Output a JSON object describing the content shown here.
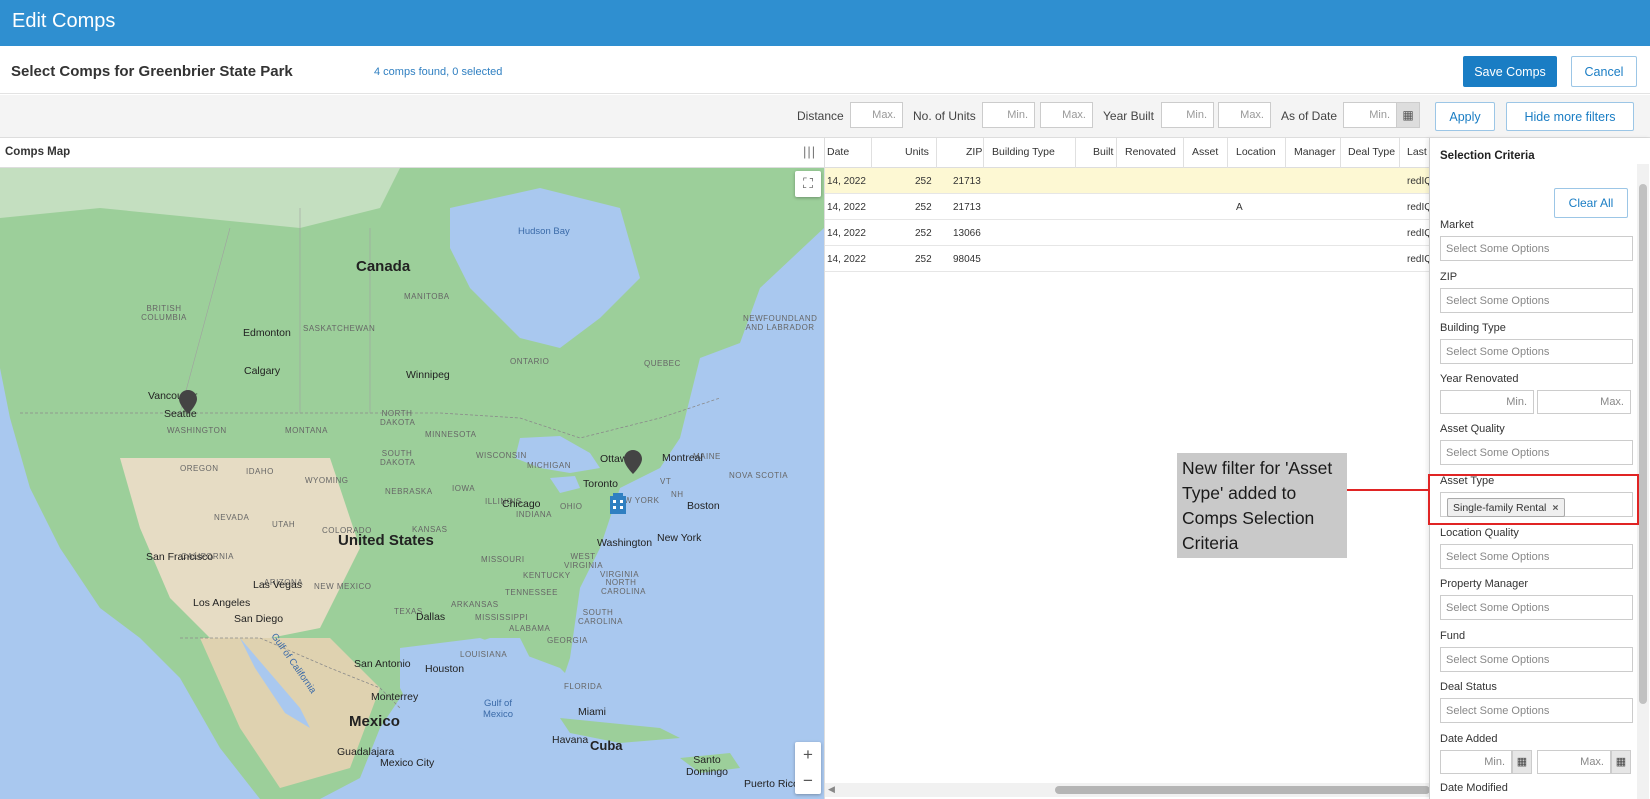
{
  "app": {
    "title": "Edit Comps"
  },
  "subheader": {
    "title": "Select Comps for Greenbrier State Park",
    "count_text": "4 comps found, 0 selected",
    "save_label": "Save Comps",
    "cancel_label": "Cancel"
  },
  "filters": {
    "distance_label": "Distance",
    "distance_placeholder": "Max.",
    "units_label": "No. of Units",
    "units_min": "Min.",
    "units_max": "Max.",
    "year_label": "Year Built",
    "year_min": "Min.",
    "year_max": "Max.",
    "asof_label": "As of Date",
    "asof_placeholder": "Min.",
    "apply_label": "Apply",
    "hide_label": "Hide more filters"
  },
  "map": {
    "header": "Comps Map",
    "labels": {
      "hudson_bay": "Hudson Bay",
      "canada": "Canada",
      "british_columbia": "BRITISH COLUMBIA",
      "manitoba": "MANITOBA",
      "saskatchewan": "SASKATCHEWAN",
      "edmonton": "Edmonton",
      "calgary": "Calgary",
      "vancouver": "Vancouver",
      "seattle": "Seattle",
      "washington_state": "WASHINGTON",
      "montana": "MONTANA",
      "oregon": "OREGON",
      "idaho": "IDAHO",
      "wyoming": "WYOMING",
      "nevada": "NEVADA",
      "utah": "UTAH",
      "colorado": "COLORADO",
      "california": "CALIFORNIA",
      "arizona": "ARIZONA",
      "new_mexico": "NEW MEXICO",
      "texas": "TEXAS",
      "ontario": "ONTARIO",
      "quebec": "QUEBEC",
      "winnipeg": "Winnipeg",
      "north_dakota": "NORTH DAKOTA",
      "south_dakota": "SOUTH DAKOTA",
      "nebraska": "NEBRASKA",
      "kansas": "KANSAS",
      "minnesota": "MINNESOTA",
      "iowa": "IOWA",
      "wisconsin": "WISCONSIN",
      "michigan": "MICHIGAN",
      "illinois": "ILLINOIS",
      "indiana": "INDIANA",
      "ohio": "OHIO",
      "missouri": "MISSOURI",
      "kentucky": "KENTUCKY",
      "tennessee": "TENNESSEE",
      "arkansas": "ARKANSAS",
      "mississippi": "MISSISSIPPI",
      "alabama": "ALABAMA",
      "georgia": "GEORGIA",
      "louisiana": "LOUISIANA",
      "south_carolina": "SOUTH CAROLINA",
      "north_carolina": "NORTH CAROLINA",
      "virginia": "VIRGINIA",
      "west_virginia": "WEST VIRGINIA",
      "new_york_state": "NEW YORK",
      "vt": "VT",
      "nh": "NH",
      "maine": "MAINE",
      "nova_scotia": "NOVA SCOTIA",
      "newfoundland": "NEWFOUNDLAND AND LABRADOR",
      "united_states": "United States",
      "san_francisco": "San Francisco",
      "las_vegas": "Las Vegas",
      "los_angeles": "Los Angeles",
      "san_diego": "San Diego",
      "dallas": "Dallas",
      "san_antonio": "San Antonio",
      "houston": "Houston",
      "chicago": "Chicago",
      "toronto": "Toronto",
      "ottawa": "Ottawa",
      "montreal": "Montreal",
      "boston": "Boston",
      "new_york": "New York",
      "washington": "Washington",
      "miami": "Miami",
      "monterrey": "Monterrey",
      "mexico": "Mexico",
      "guadalajara": "Guadalajara",
      "mexico_city": "Mexico City",
      "havana": "Havana",
      "cuba": "Cuba",
      "gulf_of_mexico": "Gulf of Mexico",
      "gulf_of_california": "Gulf of California",
      "santo_domingo": "Santo Domingo",
      "puerto_rico": "Puerto Rico",
      "florida": "FLORIDA"
    },
    "zoom_in": "+",
    "zoom_out": "−",
    "fullscreen_icon": "⛶"
  },
  "grid": {
    "columns": [
      "Date",
      "Units",
      "ZIP",
      "Building Type",
      "Built",
      "Renovated",
      "Asset",
      "Location",
      "Manager",
      "Deal Type",
      "Last I"
    ],
    "rows": [
      {
        "date": "14, 2022",
        "units": "252",
        "zip": "21713",
        "location": "",
        "last": "redIQ"
      },
      {
        "date": "14, 2022",
        "units": "252",
        "zip": "21713",
        "location": "A",
        "last": "redIQ"
      },
      {
        "date": "14, 2022",
        "units": "252",
        "zip": "13066",
        "location": "",
        "last": "redIQ"
      },
      {
        "date": "14, 2022",
        "units": "252",
        "zip": "98045",
        "location": "",
        "last": "redIQ"
      }
    ]
  },
  "panel": {
    "title": "Selection Criteria",
    "clear_label": "Clear All",
    "placeholder": "Select Some Options",
    "min": "Min.",
    "max": "Max.",
    "market": "Market",
    "zip": "ZIP",
    "building_type": "Building Type",
    "year_renovated": "Year Renovated",
    "asset_quality": "Asset Quality",
    "asset_type": "Asset Type",
    "asset_type_tag": "Single-family Rental",
    "location_quality": "Location Quality",
    "property_manager": "Property Manager",
    "fund": "Fund",
    "deal_status": "Deal Status",
    "date_added": "Date Added",
    "date_modified": "Date Modified"
  },
  "callout": {
    "text": "New filter for 'Asset Type' added to Comps Selection Criteria"
  },
  "colors": {
    "header": "#2f8fd0",
    "accent": "#1a7dc4",
    "highlight": "#e02424",
    "row_highlight": "#fdf8d3"
  }
}
